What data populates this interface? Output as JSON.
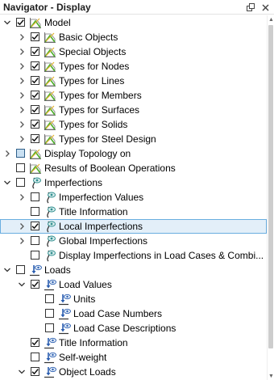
{
  "panel": {
    "title": "Navigator - Display",
    "pin_icon": "pin-icon",
    "close_icon": "close-icon"
  },
  "tree": [
    {
      "label": "Model",
      "depth": 0,
      "expander": "expanded",
      "check": "checked",
      "icon": "model-icon"
    },
    {
      "label": "Basic Objects",
      "depth": 1,
      "expander": "collapsed",
      "check": "checked",
      "icon": "model-icon"
    },
    {
      "label": "Special Objects",
      "depth": 1,
      "expander": "collapsed",
      "check": "checked",
      "icon": "model-icon"
    },
    {
      "label": "Types for Nodes",
      "depth": 1,
      "expander": "collapsed",
      "check": "checked",
      "icon": "model-icon"
    },
    {
      "label": "Types for Lines",
      "depth": 1,
      "expander": "collapsed",
      "check": "checked",
      "icon": "model-icon"
    },
    {
      "label": "Types for Members",
      "depth": 1,
      "expander": "collapsed",
      "check": "checked",
      "icon": "model-icon"
    },
    {
      "label": "Types for Surfaces",
      "depth": 1,
      "expander": "collapsed",
      "check": "checked",
      "icon": "model-icon"
    },
    {
      "label": "Types for Solids",
      "depth": 1,
      "expander": "collapsed",
      "check": "checked",
      "icon": "model-icon"
    },
    {
      "label": "Types for Steel Design",
      "depth": 1,
      "expander": "collapsed",
      "check": "checked",
      "icon": "model-icon"
    },
    {
      "label": "Display Topology on",
      "depth": 0,
      "expander": "collapsed",
      "check": "partial",
      "icon": "model-icon"
    },
    {
      "label": "Results of Boolean Operations",
      "depth": 0,
      "expander": "none",
      "check": "unchecked",
      "icon": "model-icon"
    },
    {
      "label": "Imperfections",
      "depth": 0,
      "expander": "expanded",
      "check": "unchecked",
      "icon": "imperfection-icon"
    },
    {
      "label": "Imperfection Values",
      "depth": 1,
      "expander": "collapsed",
      "check": "unchecked",
      "icon": "imperfection-icon"
    },
    {
      "label": "Title Information",
      "depth": 1,
      "expander": "none",
      "check": "unchecked",
      "icon": "imperfection-icon"
    },
    {
      "label": "Local Imperfections",
      "depth": 1,
      "expander": "collapsed",
      "check": "checked",
      "icon": "imperfection-icon",
      "selected": true
    },
    {
      "label": "Global Imperfections",
      "depth": 1,
      "expander": "collapsed",
      "check": "unchecked",
      "icon": "imperfection-icon"
    },
    {
      "label": "Display Imperfections in Load Cases & Combi...",
      "depth": 1,
      "expander": "none",
      "check": "unchecked",
      "icon": "imperfection-icon"
    },
    {
      "label": "Loads",
      "depth": 0,
      "expander": "expanded",
      "check": "unchecked",
      "icon": "load-icon"
    },
    {
      "label": "Load Values",
      "depth": 1,
      "expander": "expanded",
      "check": "checked",
      "icon": "load-icon"
    },
    {
      "label": "Units",
      "depth": 2,
      "expander": "none",
      "check": "unchecked",
      "icon": "load-icon"
    },
    {
      "label": "Load Case Numbers",
      "depth": 2,
      "expander": "none",
      "check": "unchecked",
      "icon": "load-icon"
    },
    {
      "label": "Load Case Descriptions",
      "depth": 2,
      "expander": "none",
      "check": "unchecked",
      "icon": "load-icon"
    },
    {
      "label": "Title Information",
      "depth": 1,
      "expander": "none",
      "check": "checked",
      "icon": "load-icon"
    },
    {
      "label": "Self-weight",
      "depth": 1,
      "expander": "none",
      "check": "unchecked",
      "icon": "load-icon"
    },
    {
      "label": "Object Loads",
      "depth": 1,
      "expander": "expanded",
      "check": "checked",
      "icon": "load-icon"
    }
  ],
  "colors": {
    "selection_fill": "#e3eff9",
    "selection_border": "#6aaee0",
    "model_green": "#4caf2a",
    "load_blue": "#2a5db0",
    "imperfection_teal": "#2f8f8f"
  }
}
